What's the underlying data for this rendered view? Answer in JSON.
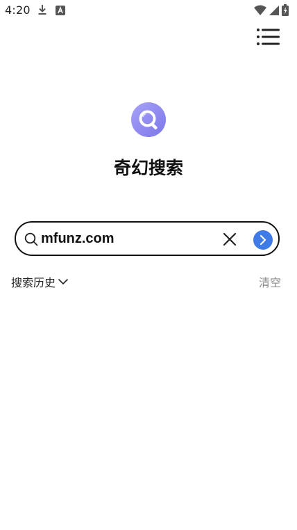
{
  "status_bar": {
    "time": "4:20",
    "left_icons": [
      "download-icon",
      "a-icon"
    ],
    "right_icons": [
      "wifi-icon",
      "signal-icon",
      "battery-icon"
    ]
  },
  "header": {
    "menu_icon": "list-menu-icon"
  },
  "app": {
    "title": "奇幻搜索",
    "logo_icon": "magnifier-logo-icon",
    "logo_color": "#8b86f0"
  },
  "search": {
    "value": "mfunz.com",
    "placeholder": "",
    "search_icon": "search-icon",
    "clear_icon": "close-icon",
    "go_icon": "chevron-right-icon",
    "go_color": "#3f7be6"
  },
  "history": {
    "label": "搜索历史",
    "toggle_icon": "chevron-down-icon",
    "clear_label": "清空"
  }
}
